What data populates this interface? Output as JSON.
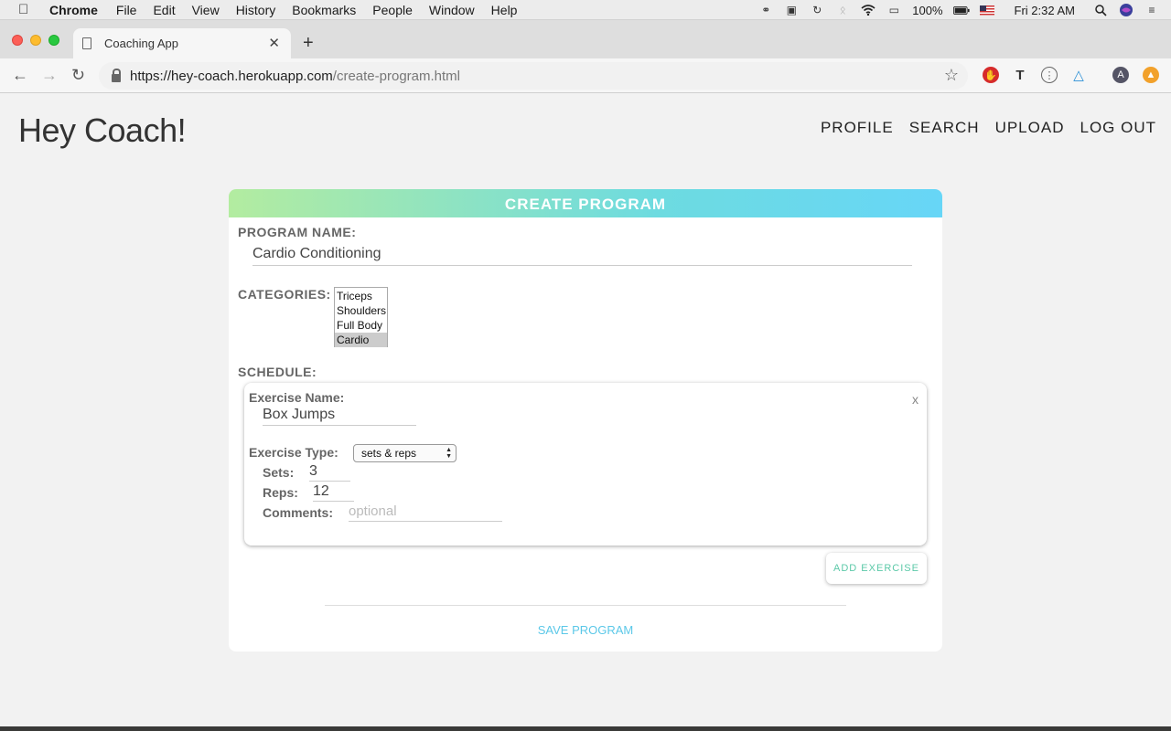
{
  "menubar": {
    "app_name": "Chrome",
    "items": [
      "File",
      "Edit",
      "View",
      "History",
      "Bookmarks",
      "People",
      "Window",
      "Help"
    ],
    "battery": "100%",
    "clock": "Fri 2:32 AM"
  },
  "browser": {
    "tab_title": "Coaching App",
    "url_host": "https://hey-coach.herokuapp.com",
    "url_path": "/create-program.html",
    "profile_initial": "A"
  },
  "site": {
    "logo": "Hey Coach!",
    "nav": [
      "PROFILE",
      "SEARCH",
      "UPLOAD",
      "LOG OUT"
    ]
  },
  "form": {
    "title": "CREATE PROGRAM",
    "program_name_label": "PROGRAM NAME:",
    "program_name_value": "Cardio Conditioning",
    "categories_label": "CATEGORIES:",
    "categories": [
      "Triceps",
      "Shoulders",
      "Full Body",
      "Cardio"
    ],
    "selected_category": "Cardio",
    "schedule_label": "SCHEDULE:",
    "exercise": {
      "close": "x",
      "name_label": "Exercise Name:",
      "name_value": "Box Jumps",
      "type_label": "Exercise Type:",
      "type_value": "sets & reps",
      "sets_label": "Sets:",
      "sets_value": "3",
      "reps_label": "Reps:",
      "reps_value": "12",
      "comments_label": "Comments:",
      "comments_placeholder": "optional"
    },
    "add_exercise": "ADD EXERCISE",
    "save_program": "SAVE PROGRAM"
  },
  "colors": {
    "header_gradient_start": "#b3eca0",
    "header_gradient_end": "#67d6f7",
    "add_button_text": "#5cc9a8",
    "save_button_text": "#5bc8e8"
  }
}
